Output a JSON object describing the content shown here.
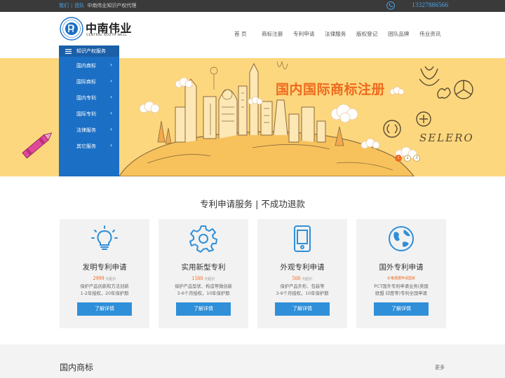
{
  "topbar": {
    "link_about": "我们",
    "separator": "|",
    "link_team": "团队",
    "tagline": "中南伟业知识产权代理",
    "phone": "13327886566"
  },
  "logo": {
    "name": "中南伟业",
    "subtitle": "CENTRAL SOUTH WELL"
  },
  "nav": [
    {
      "label": "首 页"
    },
    {
      "label": "商标注册"
    },
    {
      "label": "专利申请"
    },
    {
      "label": "法律服务"
    },
    {
      "label": "版权登记"
    },
    {
      "label": "团队品牌"
    },
    {
      "label": "伟业资讯"
    }
  ],
  "sidemenu": {
    "title": "知识产权服务",
    "items": [
      {
        "label": "国内商标"
      },
      {
        "label": "国际商标"
      },
      {
        "label": "国内专利"
      },
      {
        "label": "国际专利"
      },
      {
        "label": "法律服务"
      },
      {
        "label": "其它服务"
      }
    ],
    "arrow": "›"
  },
  "banner": {
    "title": "国内国际商标注册",
    "brand_text": "SELERO",
    "slides": [
      "1",
      "2",
      "3"
    ],
    "active_slide": 0,
    "colors": {
      "background": "#fcd77e",
      "title": "#ef6a1e",
      "line": "#8a6a3e"
    }
  },
  "section": {
    "title": "专利申请服务 | 不成功退款"
  },
  "cards": [
    {
      "icon": "lightbulb-icon",
      "title": "发明专利申请",
      "price": "2999",
      "unit": "元起价",
      "desc": [
        "保护产品创新和方法创新",
        "1-2年授权，20年保护期"
      ],
      "button": "了解详情"
    },
    {
      "icon": "gear-icon",
      "title": "实用新型专利",
      "price": "1500",
      "unit": "元起价",
      "desc": [
        "保护产品型状、构造等微创新",
        "3-6个月授权，10年保护期"
      ],
      "button": "了解详情"
    },
    {
      "icon": "tablet-icon",
      "title": "外观专利申请",
      "price": "500",
      "unit": "元起价",
      "desc": [
        "保护产品外形、包装等",
        "3-6个月授权，10年保护期"
      ],
      "button": "了解详情"
    },
    {
      "icon": "globe-icon",
      "title": "国外专利申请",
      "note": "价格根据申请国家",
      "desc": [
        "PCT国外专利申请业务(美国",
        "欧盟 印度等)专利全国申请"
      ],
      "button": "了解详情"
    }
  ],
  "bottom": {
    "title": "国内商标",
    "more": "更多"
  },
  "colors": {
    "accent": "#2f8fd8",
    "sidemenu": "#1b6fc5",
    "price": "#ef6a1e",
    "topbar": "#3a3a3a"
  }
}
